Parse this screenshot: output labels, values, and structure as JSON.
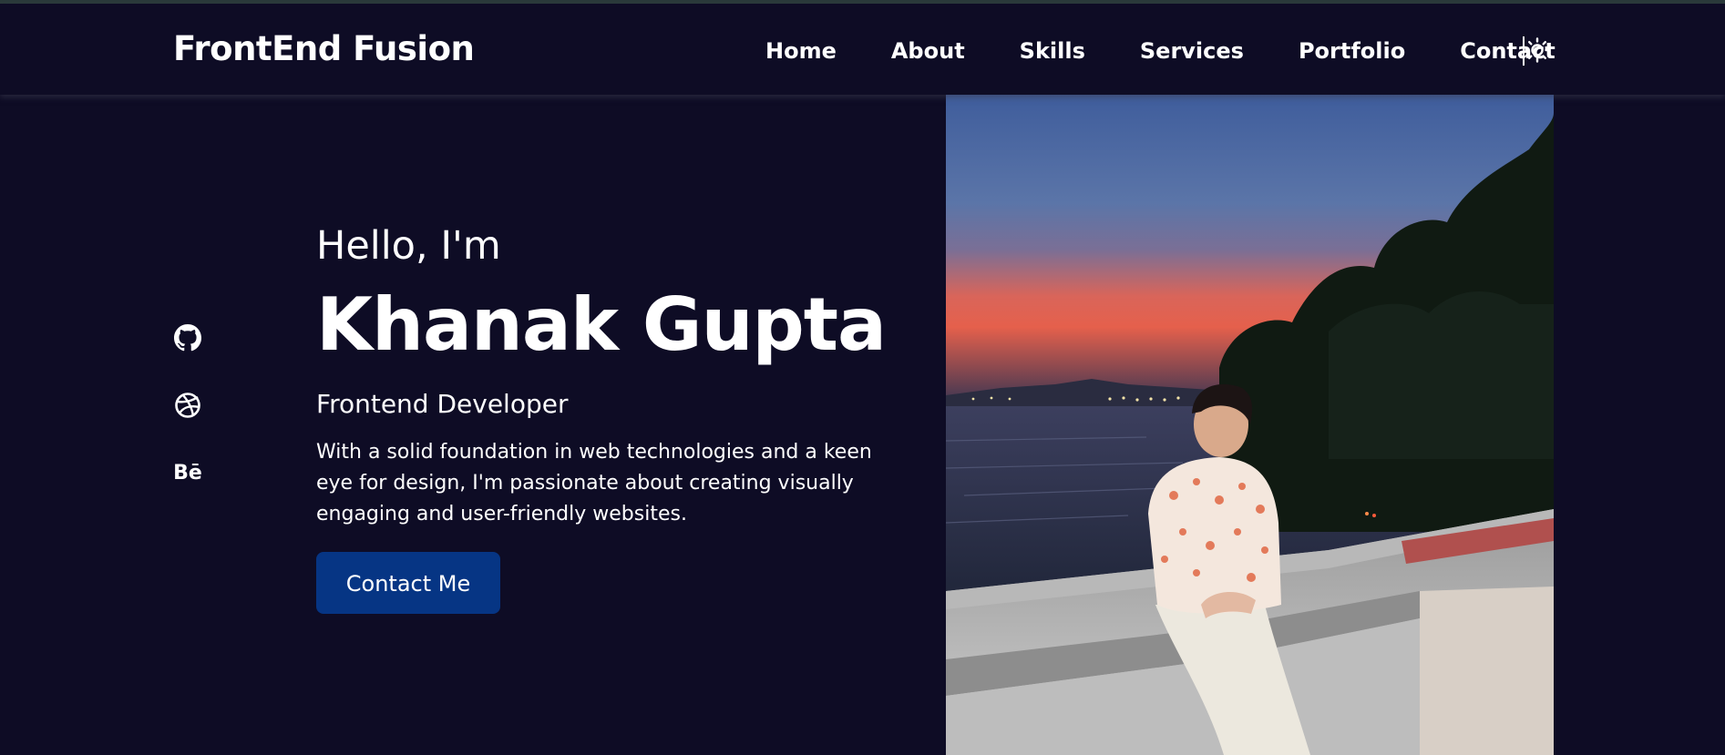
{
  "header": {
    "brand": "FrontEnd Fusion",
    "nav": [
      "Home",
      "About",
      "Skills",
      "Services",
      "Portfolio",
      "Contact"
    ],
    "theme_toggle_icon": "sun-icon"
  },
  "social": {
    "items": [
      {
        "icon": "github-icon"
      },
      {
        "icon": "dribbble-icon"
      },
      {
        "icon": "behance-icon",
        "text": "Bē"
      }
    ]
  },
  "hero": {
    "greeting": "Hello, I'm",
    "name": "Khanak Gupta",
    "role": "Frontend Developer",
    "description": "With a solid foundation in web technologies and a keen eye for design, I'm passionate about creating visually engaging and user-friendly websites.",
    "cta": "Contact Me"
  },
  "colors": {
    "background": "#0e0c25",
    "button": "#063584",
    "text": "#ffffff"
  }
}
